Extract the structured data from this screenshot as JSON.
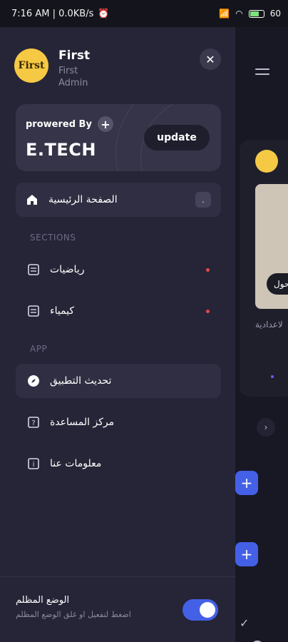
{
  "status_bar": {
    "time_and_speed": "7:16 AM | 0.0KB/s",
    "battery": "60"
  },
  "background_app": {
    "card_text": "لاعدادية",
    "pill_text": "حول"
  },
  "drawer": {
    "profile": {
      "avatar_text": "First",
      "name": "First",
      "subtitle": "First",
      "role": "Admin"
    },
    "promo": {
      "powered_label": "prowered By",
      "brand": "E.TECH",
      "update_label": "update"
    },
    "home": {
      "label": "الصفحة الرئيسية",
      "badge": "."
    },
    "sections_heading": "SECTIONS",
    "sections": [
      {
        "label": "رياضيات"
      },
      {
        "label": "كيمياء"
      }
    ],
    "app_heading": "APP",
    "app_items": [
      {
        "label": "تحديث التطبيق"
      },
      {
        "label": "مركز المساعدة"
      },
      {
        "label": "معلومات عنا"
      }
    ],
    "dark_mode": {
      "title": "الوضع المظلم",
      "subtitle": "اضغط لتفعيل او غلق الوضع المظلم",
      "enabled": true
    }
  },
  "colors": {
    "drawer_bg": "#262537",
    "accent": "#4460e6",
    "notification_dot": "#e04a4a"
  }
}
